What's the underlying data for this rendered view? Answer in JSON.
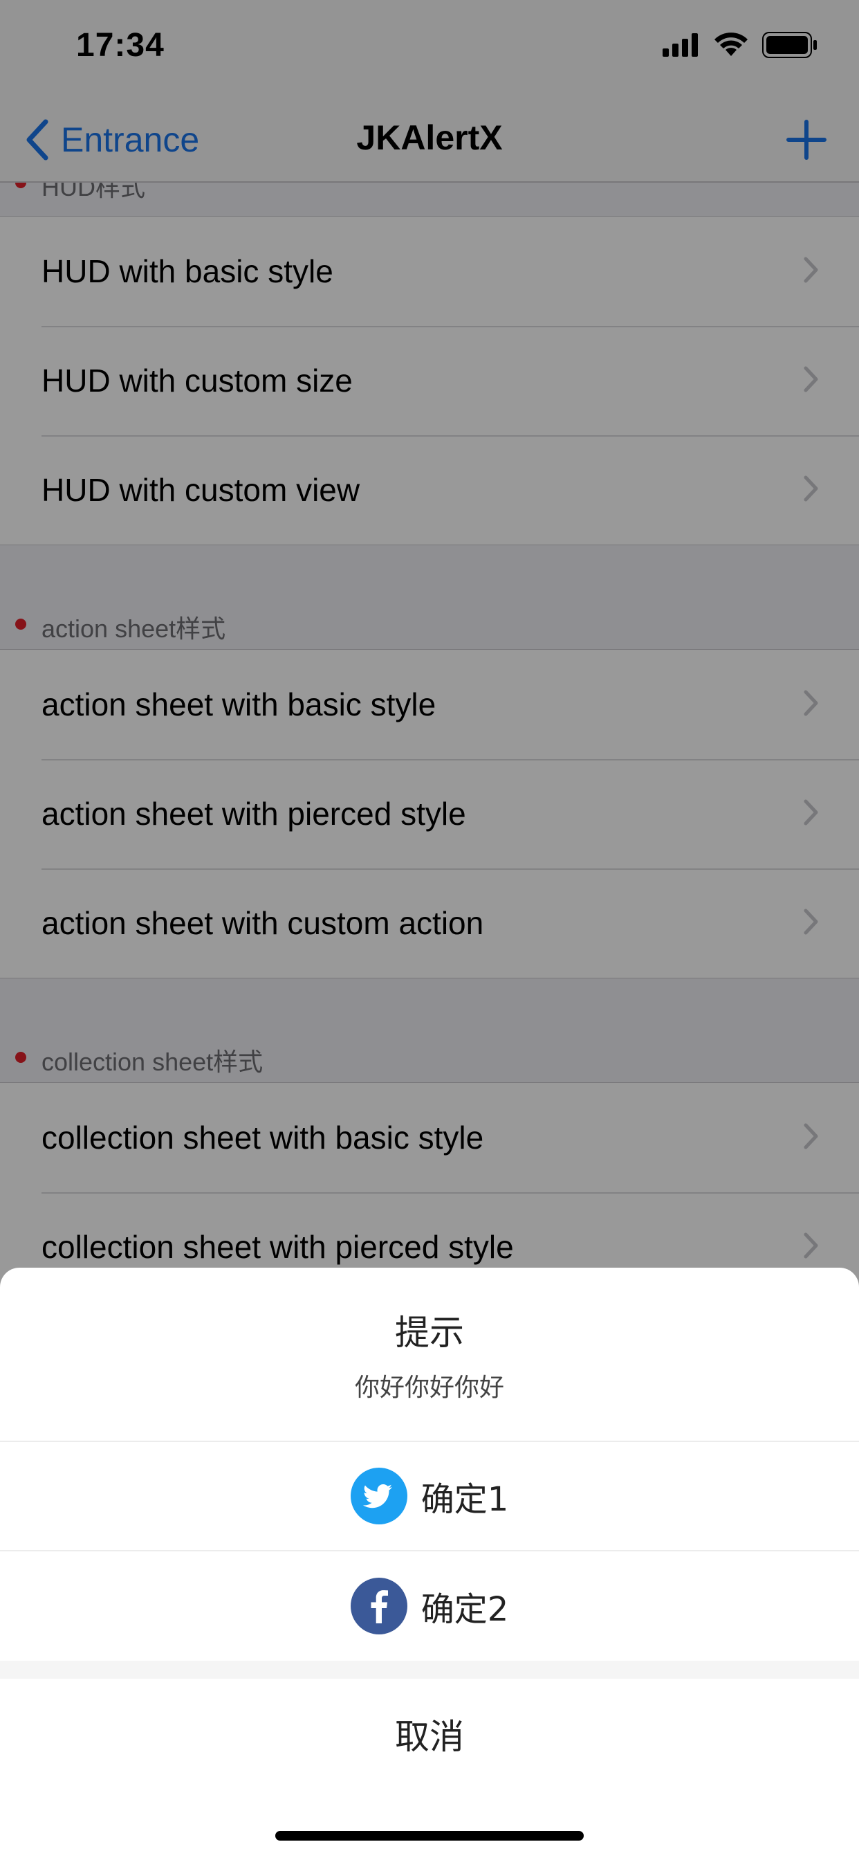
{
  "status_bar": {
    "time": "17:34"
  },
  "navbar": {
    "back_label": "Entrance",
    "title": "JKAlertX"
  },
  "sections": [
    {
      "title": "HUD样式",
      "items": [
        "HUD with basic style",
        "HUD with custom size",
        "HUD with custom view"
      ]
    },
    {
      "title": "action sheet样式",
      "items": [
        "action sheet with basic style",
        "action sheet with pierced style",
        "action sheet with custom action"
      ]
    },
    {
      "title": "collection sheet样式",
      "items": [
        "collection sheet with basic style",
        "collection sheet with pierced style"
      ]
    }
  ],
  "sheet": {
    "title": "提示",
    "message": "你好你好你好",
    "actions": [
      {
        "label": "确定1",
        "icon": "twitter-icon",
        "color": "#1da1f2"
      },
      {
        "label": "确定2",
        "icon": "facebook-icon",
        "color": "#3b5998"
      }
    ],
    "cancel_label": "取消"
  },
  "colors": {
    "accent": "#1a73e8",
    "section_dot": "#e0202a",
    "overlay": "rgba(0,0,0,0.40)"
  }
}
